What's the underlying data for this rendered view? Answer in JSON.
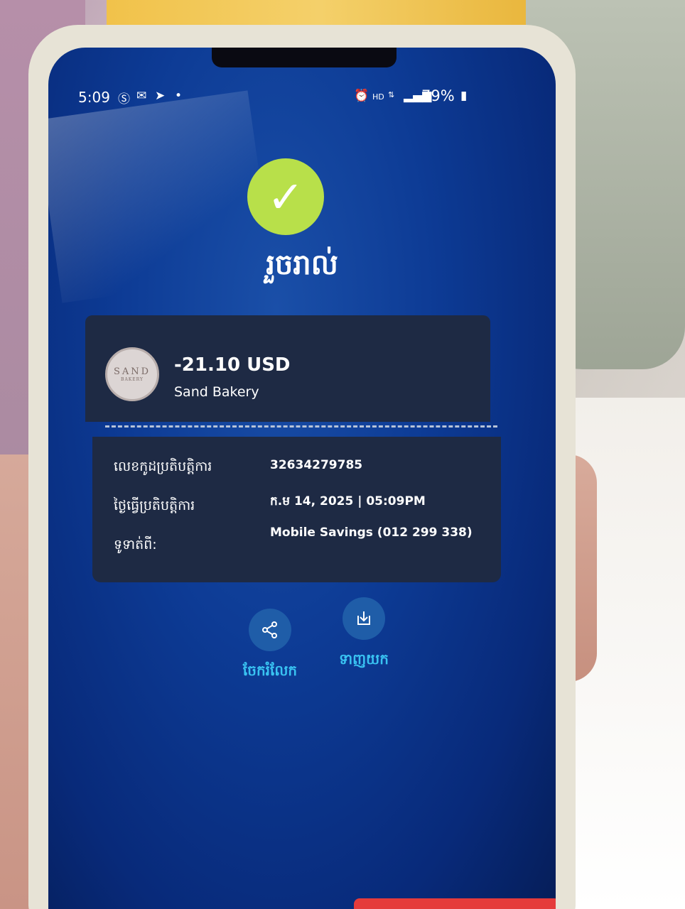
{
  "status_bar": {
    "time": "5:09",
    "battery": "79%"
  },
  "success": {
    "title": "រួចរាល់"
  },
  "transaction": {
    "amount": "-21.10 USD",
    "merchant_name": "Sand Bakery",
    "merchant_logo_text": "SAND",
    "merchant_logo_subtext": "BAKERY"
  },
  "details": {
    "transaction_id_label": "លេខកូដប្រតិបត្តិការ",
    "transaction_id_value": "32634279785",
    "date_label": "ថ្ងៃធ្វើប្រតិបត្តិការ",
    "date_value": "ក.ម 14, 2025 | 05:09PM",
    "from_label": "ទូទាត់ពី:",
    "from_value": "Mobile Savings (012 299 338)"
  },
  "actions": {
    "share_label": "ចែករំលែក",
    "download_label": "ទាញយក"
  },
  "colors": {
    "success_green": "#b8e04a",
    "action_text": "#39c3f2",
    "card_bg": "#1e2a44",
    "screen_bg": "#0d3b95"
  }
}
